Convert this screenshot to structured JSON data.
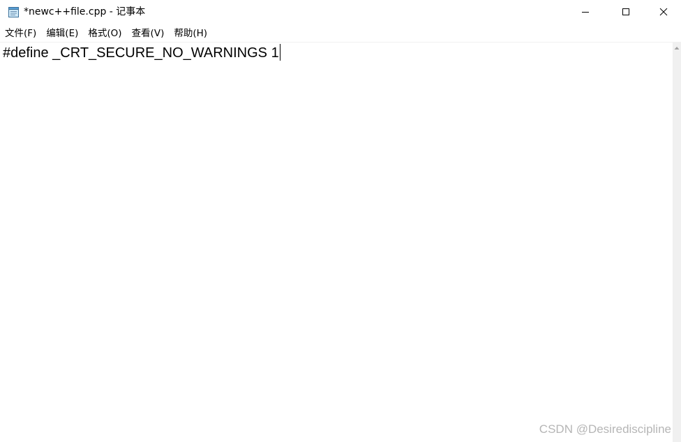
{
  "window": {
    "title": "*newc++file.cpp - 记事本",
    "icon": "notepad-icon",
    "controls": {
      "minimize_icon": "minimize-icon",
      "maximize_icon": "maximize-icon",
      "close_icon": "close-icon"
    }
  },
  "menubar": {
    "items": [
      {
        "label": "文件(F)"
      },
      {
        "label": "编辑(E)"
      },
      {
        "label": "格式(O)"
      },
      {
        "label": "查看(V)"
      },
      {
        "label": "帮助(H)"
      }
    ]
  },
  "editor": {
    "lines": [
      "#define _CRT_SECURE_NO_WARNINGS 1"
    ]
  },
  "watermark": "CSDN @Desirediscipline"
}
